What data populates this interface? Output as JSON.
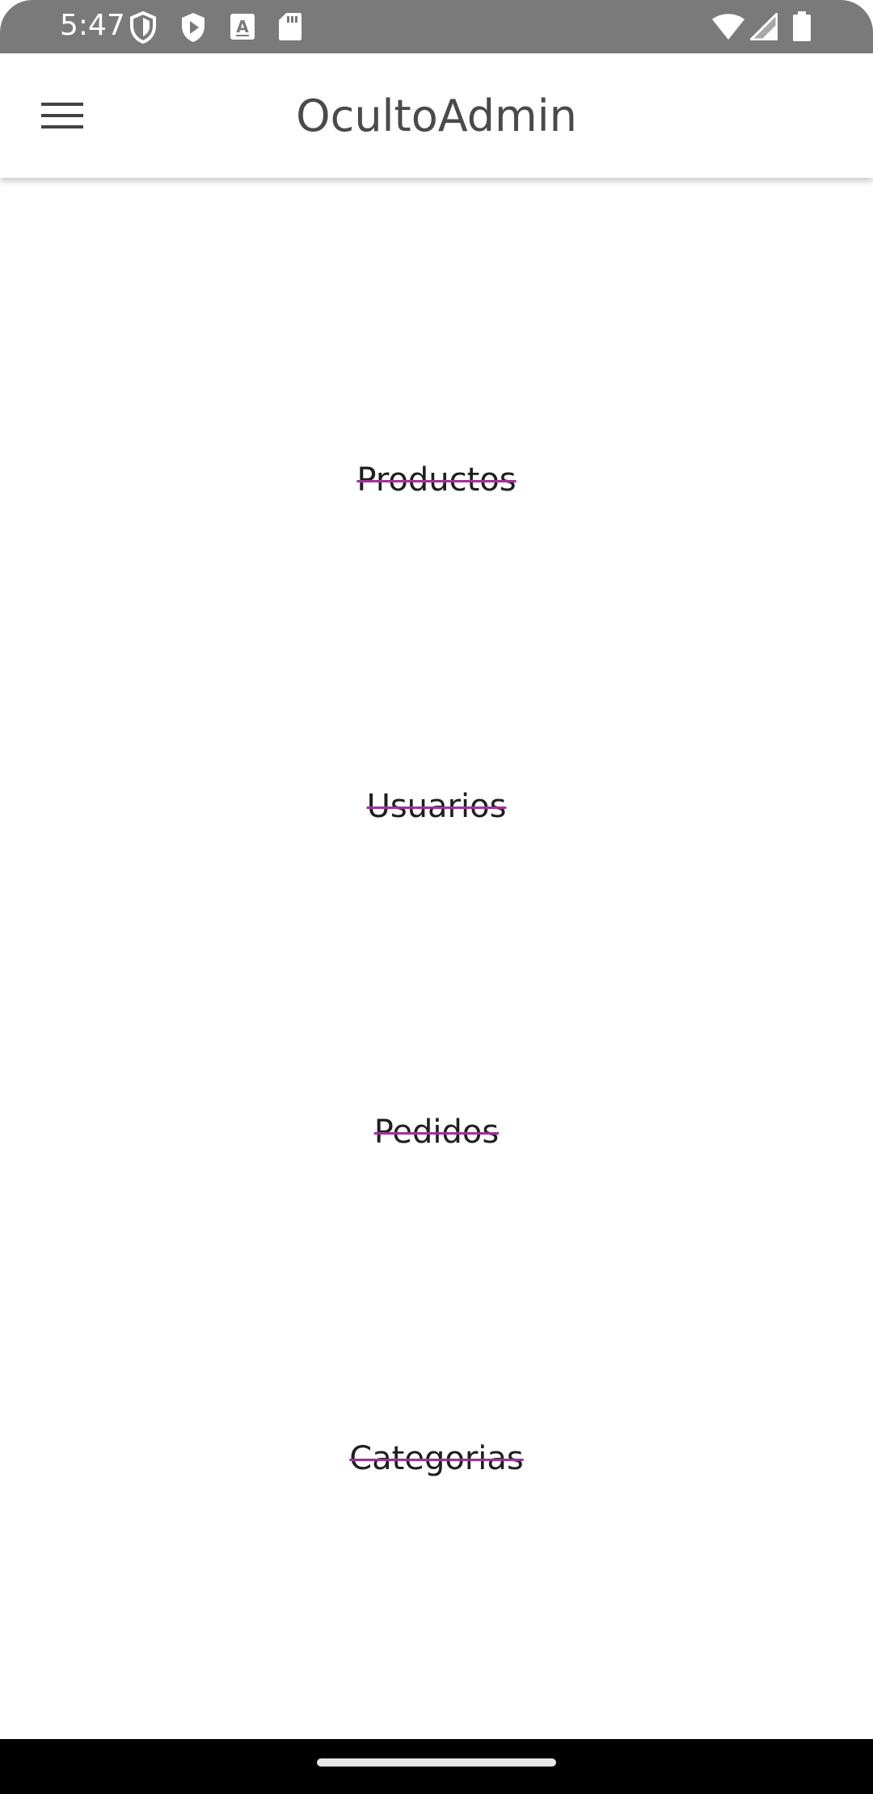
{
  "status_bar": {
    "time": "5:47",
    "icons": [
      "shield-icon",
      "play-store-icon",
      "font-a-icon",
      "sd-card-icon",
      "wifi-icon",
      "signal-icon",
      "battery-icon"
    ]
  },
  "app_bar": {
    "menu_icon": "menu-icon",
    "title": "OcultoAdmin"
  },
  "menu_items": [
    {
      "label": "Productos"
    },
    {
      "label": "Usuarios"
    },
    {
      "label": "Pedidos"
    },
    {
      "label": "Categorias"
    }
  ],
  "colors": {
    "status_bar_bg": "#7a7a7a",
    "strike_color": "#a0329a",
    "text_color": "#1f1f1f",
    "title_color": "#4a4a4a",
    "nav_bar_bg": "#000000"
  }
}
